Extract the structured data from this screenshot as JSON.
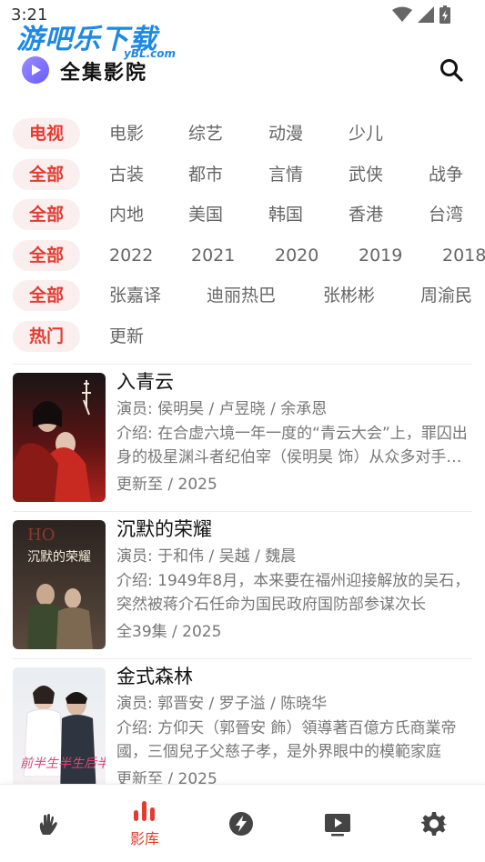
{
  "status": {
    "time": "3:21"
  },
  "watermark": {
    "text": "游吧乐下载",
    "sub": "yBL.com"
  },
  "header": {
    "title": "全集影院",
    "logo": "play-logo-icon",
    "search_icon": "search-icon"
  },
  "filters": [
    {
      "active": "电视",
      "options": [
        "电影",
        "综艺",
        "动漫",
        "少儿"
      ]
    },
    {
      "active": "全部",
      "options": [
        "古装",
        "都市",
        "言情",
        "武侠",
        "战争"
      ]
    },
    {
      "active": "全部",
      "options": [
        "内地",
        "美国",
        "韩国",
        "香港",
        "台湾"
      ]
    },
    {
      "active": "全部",
      "options": [
        "2022",
        "2021",
        "2020",
        "2019",
        "2018"
      ]
    },
    {
      "active": "全部",
      "options": [
        "张嘉译",
        "迪丽热巴",
        "张彬彬",
        "周渝民"
      ]
    },
    {
      "active": "热门",
      "options": [
        "更新"
      ]
    }
  ],
  "items": [
    {
      "title": "入青云",
      "actors": "演员: 侯明昊 / 卢昱晓 / 余承恩",
      "intro": "介绍: 在合虚六境一年一度的“青云大会”上，罪囚出身的极星渊斗者纪伯宰（侯明昊 饰）从众多对手中脱颖而出",
      "meta": "更新至 / 2025",
      "poster_text": "入青云"
    },
    {
      "title": "沉默的荣耀",
      "actors": "演员: 于和伟 / 吴越 / 魏晨",
      "intro": "介绍: 1949年8月，本来要在福州迎接解放的吴石，突然被蒋介石任命为国民政府国防部参谋次长",
      "meta": "全39集 / 2025",
      "poster_text": "沉默的荣耀"
    },
    {
      "title": "金式森林",
      "actors": "演员: 郭晋安 / 罗子溢 / 陈晓华",
      "intro": "介绍: 方仰天（郭晉安 飾）領導著百億方氏商業帝國，三個兒子父慈子孝，是外界眼中的模範家庭",
      "meta": "更新至 / 2025",
      "poster_text": "前半生半生后半生"
    }
  ],
  "nav": [
    {
      "icon": "hand-icon",
      "label": ""
    },
    {
      "icon": "chart-bars-icon",
      "label": "影库",
      "active": true
    },
    {
      "icon": "lightning-icon",
      "label": ""
    },
    {
      "icon": "video-list-icon",
      "label": ""
    },
    {
      "icon": "gear-icon",
      "label": ""
    }
  ],
  "colors": {
    "accent": "#e23b32",
    "chip_bg": "#fbeeee",
    "text_secondary": "#777777"
  }
}
